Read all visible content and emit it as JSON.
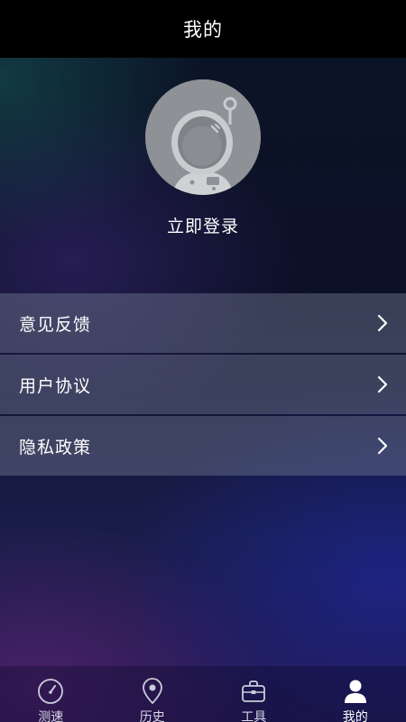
{
  "header": {
    "title": "我的"
  },
  "profile": {
    "avatar_icon": "astronaut-avatar-icon",
    "login_label": "立即登录"
  },
  "menu": {
    "items": [
      {
        "label": "意见反馈",
        "icon": "chevron-right-icon"
      },
      {
        "label": "用户协议",
        "icon": "chevron-right-icon"
      },
      {
        "label": "隐私政策",
        "icon": "chevron-right-icon"
      }
    ]
  },
  "tabbar": {
    "tabs": [
      {
        "label": "测速",
        "icon": "speedometer-icon",
        "active": false
      },
      {
        "label": "历史",
        "icon": "location-pin-icon",
        "active": false
      },
      {
        "label": "工具",
        "icon": "toolbox-icon",
        "active": false
      },
      {
        "label": "我的",
        "icon": "user-icon",
        "active": true
      }
    ]
  },
  "colors": {
    "topbar_bg": "#000000",
    "text": "#ffffff",
    "menu_bg": "#6b7390",
    "avatar_bg": "#8e9196"
  }
}
